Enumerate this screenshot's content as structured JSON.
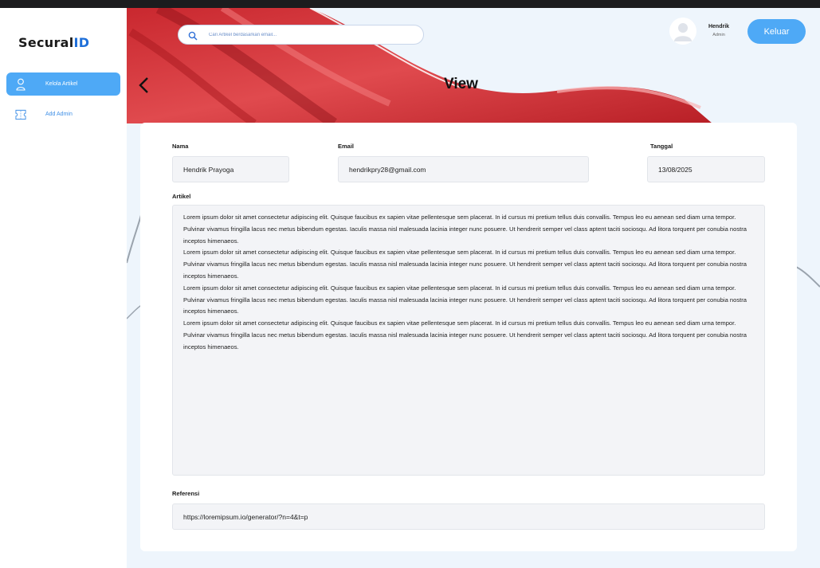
{
  "app": {
    "logo_main": "Secural",
    "logo_accent": "ID"
  },
  "sidebar": {
    "items": [
      {
        "label": "Kelola Artikel",
        "icon": "user-icon",
        "active": true
      },
      {
        "label": "Add Admin",
        "icon": "ticket-icon",
        "active": false
      }
    ]
  },
  "header": {
    "search_placeholder": "Cari Artikel berdasarkan email...",
    "user": {
      "name": "Hendrik",
      "role": "Admin"
    },
    "logout_label": "Keluar"
  },
  "page": {
    "title": "View",
    "back_icon": "chevron-left-icon"
  },
  "form": {
    "nama": {
      "label": "Nama",
      "value": "Hendrik Prayoga"
    },
    "email": {
      "label": "Email",
      "value": "hendrikpry28@gmail.com"
    },
    "tanggal": {
      "label": "Tanggal",
      "value": "13/08/2025"
    },
    "artikel": {
      "label": "Artikel",
      "paragraphs": [
        "Lorem ipsum dolor sit amet consectetur adipiscing elit. Quisque faucibus ex sapien vitae pellentesque sem placerat. In id cursus mi pretium tellus duis convallis. Tempus leo eu aenean sed diam urna tempor. Pulvinar vivamus fringilla lacus nec metus bibendum egestas. Iaculis massa nisl malesuada lacinia integer nunc posuere. Ut hendrerit semper vel class aptent taciti sociosqu. Ad litora torquent per conubia nostra inceptos himenaeos.",
        "Lorem ipsum dolor sit amet consectetur adipiscing elit. Quisque faucibus ex sapien vitae pellentesque sem placerat. In id cursus mi pretium tellus duis convallis. Tempus leo eu aenean sed diam urna tempor. Pulvinar vivamus fringilla lacus nec metus bibendum egestas. Iaculis massa nisl malesuada lacinia integer nunc posuere. Ut hendrerit semper vel class aptent taciti sociosqu. Ad litora torquent per conubia nostra inceptos himenaeos.",
        "Lorem ipsum dolor sit amet consectetur adipiscing elit. Quisque faucibus ex sapien vitae pellentesque sem placerat. In id cursus mi pretium tellus duis convallis. Tempus leo eu aenean sed diam urna tempor. Pulvinar vivamus fringilla lacus nec metus bibendum egestas. Iaculis massa nisl malesuada lacinia integer nunc posuere. Ut hendrerit semper vel class aptent taciti sociosqu. Ad litora torquent per conubia nostra inceptos himenaeos.",
        "Lorem ipsum dolor sit amet consectetur adipiscing elit. Quisque faucibus ex sapien vitae pellentesque sem placerat. In id cursus mi pretium tellus duis convallis. Tempus leo eu aenean sed diam urna tempor. Pulvinar vivamus fringilla lacus nec metus bibendum egestas. Iaculis massa nisl malesuada lacinia integer nunc posuere. Ut hendrerit semper vel class aptent taciti sociosqu. Ad litora torquent per conubia nostra inceptos himenaeos."
      ]
    },
    "referensi": {
      "label": "Referensi",
      "value": "https://loremipsum.io/generator/?n=4&t=p"
    }
  },
  "colors": {
    "accent": "#4ea9f6",
    "logo_accent": "#1e6fd9",
    "banner_red": "#d9343a",
    "background": "#eef5fc"
  }
}
